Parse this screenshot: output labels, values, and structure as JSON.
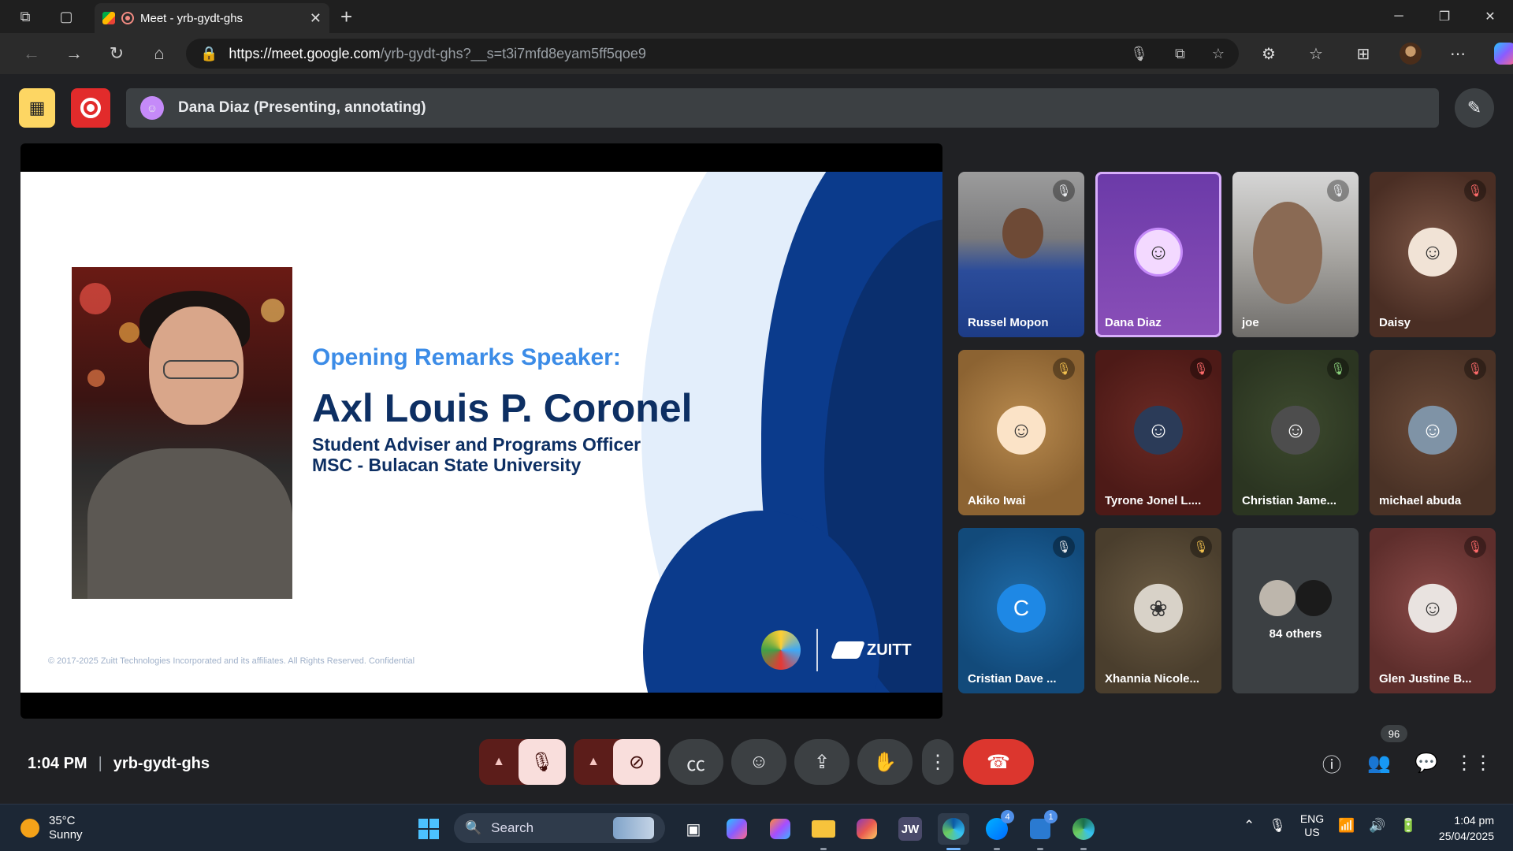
{
  "browser": {
    "tab_title": "Meet - yrb-gydt-ghs",
    "url_host": "https://meet.google.com",
    "url_path": "/yrb-gydt-ghs?__s=t3i7mfd8eyam5ff5qoe9"
  },
  "meet": {
    "presenter_bar": "Dana Diaz (Presenting, annotating)",
    "time": "1:04 PM",
    "meeting_code": "yrb-gydt-ghs",
    "participant_count": "96"
  },
  "slide": {
    "label": "Opening Remarks Speaker:",
    "name": "Axl Louis P. Coronel",
    "role_line1": "Student Adviser and Programs Officer",
    "role_line2": "MSC - Bulacan State University",
    "copyright": "© 2017-2025 Zuitt Technologies Incorporated and its affiliates. All Rights Reserved. Confidential",
    "brand": "ZUITT"
  },
  "tiles": [
    {
      "name": "Russel Mopon",
      "mic": "muted"
    },
    {
      "name": "Dana Diaz",
      "mic": "active"
    },
    {
      "name": "joe",
      "mic": "muted"
    },
    {
      "name": "Daisy",
      "mic": "muted"
    },
    {
      "name": "Akiko Iwai",
      "mic": "muted"
    },
    {
      "name": "Tyrone Jonel L....",
      "mic": "muted"
    },
    {
      "name": "Christian Jame...",
      "mic": "muted"
    },
    {
      "name": "michael abuda",
      "mic": "muted"
    },
    {
      "name": "Cristian Dave ...",
      "mic": "muted",
      "initial": "C"
    },
    {
      "name": "Xhannia Nicole...",
      "mic": "muted"
    },
    {
      "name": "84 others",
      "mic": ""
    },
    {
      "name": "Glen Justine B...",
      "mic": "muted"
    }
  ],
  "taskbar": {
    "temperature": "35°C",
    "weather": "Sunny",
    "search_placeholder": "Search",
    "lang_line1": "ENG",
    "lang_line2": "US",
    "clock_time": "1:04 pm",
    "clock_date": "25/04/2025",
    "apps": [
      {
        "icon": "windows-start-icon"
      },
      {
        "icon": "task-view-icon"
      },
      {
        "icon": "copilot-icon"
      },
      {
        "icon": "m365-icon"
      },
      {
        "icon": "file-explorer-icon"
      },
      {
        "icon": "instagram-icon"
      },
      {
        "icon": "jw-library-icon",
        "label": "JW"
      },
      {
        "icon": "edge-icon"
      },
      {
        "icon": "messenger-icon",
        "badge": "4"
      },
      {
        "icon": "visual-studio-code-icon",
        "badge": "1"
      },
      {
        "icon": "edge-beta-icon"
      }
    ]
  },
  "colors": {
    "meet_bg": "#202124",
    "slide_navy": "#0d2f63",
    "slide_accent": "#3c8ce7",
    "hangup_red": "#dc362e",
    "not_recording_yellow": "#fdd663"
  }
}
